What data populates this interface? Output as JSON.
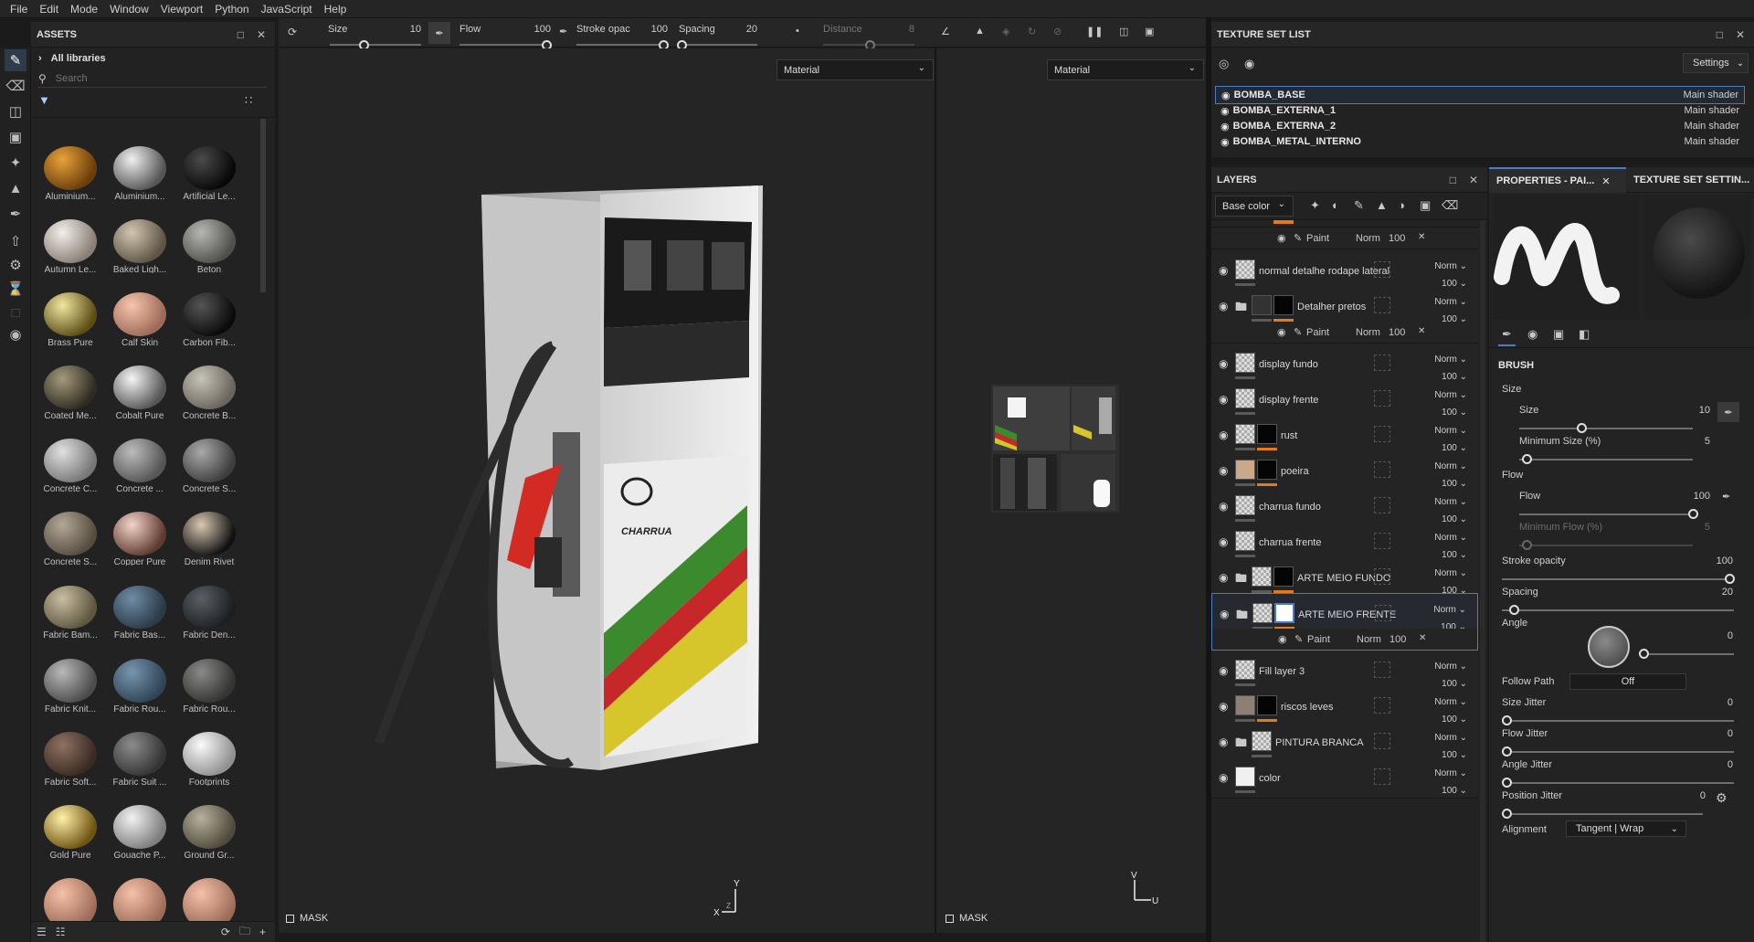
{
  "menu": [
    "File",
    "Edit",
    "Mode",
    "Window",
    "Viewport",
    "Python",
    "JavaScript",
    "Help"
  ],
  "assets": {
    "title": "ASSETS",
    "all_libraries": "All libraries",
    "search_placeholder": "Search",
    "items": [
      {
        "label": "Aluminium...",
        "c1": "#e8a23a",
        "c2": "#6a3d0a"
      },
      {
        "label": "Aluminium...",
        "c1": "#f0f0f0",
        "c2": "#555"
      },
      {
        "label": "Artificial Le...",
        "c1": "#4a4a4a",
        "c2": "#080808"
      },
      {
        "label": "Autumn Le...",
        "c1": "#f2efe9",
        "c2": "#8a7f76"
      },
      {
        "label": "Baked Ligh...",
        "c1": "#d2c6b2",
        "c2": "#5e5444"
      },
      {
        "label": "Beton",
        "c1": "#b7b7b2",
        "c2": "#4f4f4c"
      },
      {
        "label": "Brass Pure",
        "c1": "#f1e6a1",
        "c2": "#5c4d14"
      },
      {
        "label": "Calf Skin",
        "c1": "#f7c4ad",
        "c2": "#9c6a58"
      },
      {
        "label": "Carbon Fib...",
        "c1": "#555",
        "c2": "#0a0a0a"
      },
      {
        "label": "Coated Me...",
        "c1": "#a39a7c",
        "c2": "#2f2b20"
      },
      {
        "label": "Cobalt Pure",
        "c1": "#f5f5f5",
        "c2": "#555"
      },
      {
        "label": "Concrete B...",
        "c1": "#c8c3b8",
        "c2": "#6a655c"
      },
      {
        "label": "Concrete C...",
        "c1": "#e0e0e0",
        "c2": "#777"
      },
      {
        "label": "Concrete ...",
        "c1": "#bcbcbc",
        "c2": "#555"
      },
      {
        "label": "Concrete S...",
        "c1": "#a9a9a9",
        "c2": "#3e3e3e"
      },
      {
        "label": "Concrete S...",
        "c1": "#b3a898",
        "c2": "#564d40"
      },
      {
        "label": "Copper Pure",
        "c1": "#f3d3c8",
        "c2": "#5e3a30"
      },
      {
        "label": "Denim Rivet",
        "c1": "#d8c8b2",
        "c2": "#111"
      },
      {
        "label": "Fabric Bam...",
        "c1": "#c8bea3",
        "c2": "#5e573f"
      },
      {
        "label": "Fabric Bas...",
        "c1": "#6f8ca4",
        "c2": "#2a3a48"
      },
      {
        "label": "Fabric Den...",
        "c1": "#5b6066",
        "c2": "#1c1f22"
      },
      {
        "label": "Fabric Knit...",
        "c1": "#b9b9b9",
        "c2": "#4c4c4c"
      },
      {
        "label": "Fabric Rou...",
        "c1": "#7895ad",
        "c2": "#2f4456"
      },
      {
        "label": "Fabric Rou...",
        "c1": "#8a8a88",
        "c2": "#333331"
      },
      {
        "label": "Fabric Soft...",
        "c1": "#8e7262",
        "c2": "#3a2a22"
      },
      {
        "label": "Fabric Suit ...",
        "c1": "#8c8c8c",
        "c2": "#343434"
      },
      {
        "label": "Footprints",
        "c1": "#fafafa",
        "c2": "#909090"
      },
      {
        "label": "Gold Pure",
        "c1": "#fff1a8",
        "c2": "#6e5412"
      },
      {
        "label": "Gouache P...",
        "c1": "#f2f2f2",
        "c2": "#7d7d7d"
      },
      {
        "label": "Ground Gr...",
        "c1": "#b7b09d",
        "c2": "#4f4a3c"
      },
      {
        "label": "",
        "c1": "#f6c0a8",
        "c2": "#9b6a56"
      },
      {
        "label": "",
        "c1": "#f6c0a8",
        "c2": "#9b6a56"
      },
      {
        "label": "",
        "c1": "#f6c0a8",
        "c2": "#9b6a56"
      }
    ]
  },
  "toolbar": {
    "size_label": "Size",
    "size_value": "10",
    "flow_label": "Flow",
    "flow_value": "100",
    "stroke_label": "Stroke opac",
    "stroke_value": "100",
    "spacing_label": "Spacing",
    "spacing_value": "20",
    "distance_label": "Distance",
    "distance_value": "8"
  },
  "viewport3d": {
    "material": "Material",
    "mask": "MASK",
    "axis_y": "Y",
    "axis_x": "X",
    "axis_z": "Z",
    "logo_text": "CHARRUA"
  },
  "viewport2d": {
    "material": "Material",
    "mask": "MASK",
    "axis_v": "V",
    "axis_u": "U"
  },
  "texture_set_list": {
    "title": "TEXTURE SET LIST",
    "settings": "Settings",
    "items": [
      {
        "name": "BOMBA_BASE",
        "shader": "Main shader"
      },
      {
        "name": "BOMBA_EXTERNA_1",
        "shader": "Main shader"
      },
      {
        "name": "BOMBA_EXTERNA_2",
        "shader": "Main shader"
      },
      {
        "name": "BOMBA_METAL_INTERNO",
        "shader": "Main shader"
      }
    ]
  },
  "layers": {
    "title": "LAYERS",
    "channel": "Base color",
    "paint_label": "Paint",
    "norm": "Norm",
    "hundred": "100",
    "rows": [
      {
        "name": "normal detalhe rodape lateral",
        "folder": false,
        "mask": "none",
        "thumb": "check"
      },
      {
        "name": "Detalher pretos",
        "folder": true,
        "mask": "black",
        "thumb": "dark"
      },
      {
        "name": "display fundo",
        "folder": false,
        "mask": "none",
        "thumb": "check"
      },
      {
        "name": "display frente",
        "folder": false,
        "mask": "none",
        "thumb": "check"
      },
      {
        "name": "rust",
        "folder": false,
        "mask": "black",
        "thumb": "check"
      },
      {
        "name": "poeira",
        "folder": false,
        "mask": "black",
        "thumb": "tan"
      },
      {
        "name": "charrua fundo",
        "folder": false,
        "mask": "none",
        "thumb": "check"
      },
      {
        "name": "charrua frente",
        "folder": false,
        "mask": "none",
        "thumb": "check"
      },
      {
        "name": "ARTE MEIO FUNDO",
        "folder": true,
        "mask": "black",
        "thumb": "check"
      },
      {
        "name": "ARTE MEIO FRENTE",
        "folder": true,
        "mask": "white",
        "thumb": "check"
      },
      {
        "name": "Fill layer 3",
        "folder": false,
        "mask": "none",
        "thumb": "check"
      },
      {
        "name": "riscos leves",
        "folder": false,
        "mask": "black",
        "thumb": "taupe"
      },
      {
        "name": "PINTURA BRANCA",
        "folder": true,
        "mask": "none",
        "thumb": "check"
      },
      {
        "name": "color",
        "folder": false,
        "mask": "none",
        "thumb": "white"
      }
    ]
  },
  "properties": {
    "tab1": "PROPERTIES - PAI...",
    "tab2": "TEXTURE SET SETTIN...",
    "brush": "BRUSH",
    "size_group": "Size",
    "size": "Size",
    "size_v": "10",
    "minsize": "Minimum Size (%)",
    "minsize_v": "5",
    "flow_group": "Flow",
    "flow": "Flow",
    "flow_v": "100",
    "minflow": "Minimum Flow (%)",
    "minflow_v": "5",
    "stroke": "Stroke opacity",
    "stroke_v": "100",
    "spacing": "Spacing",
    "spacing_v": "20",
    "angle": "Angle",
    "angle_v": "0",
    "follow": "Follow Path",
    "follow_v": "Off",
    "sizej": "Size Jitter",
    "sizej_v": "0",
    "flowj": "Flow Jitter",
    "flowj_v": "0",
    "anglej": "Angle Jitter",
    "anglej_v": "0",
    "posj": "Position Jitter",
    "posj_v": "0",
    "align": "Alignment",
    "align_v": "Tangent | Wrap"
  }
}
